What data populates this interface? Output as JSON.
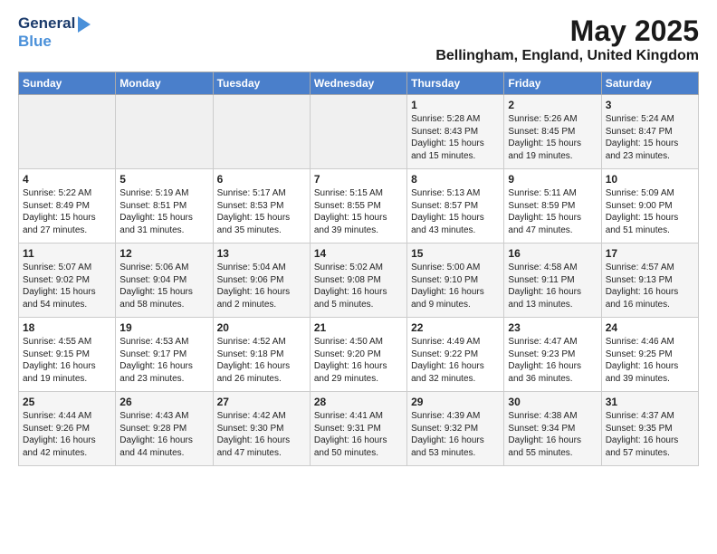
{
  "logo": {
    "line1": "General",
    "line2": "Blue"
  },
  "title": "May 2025",
  "subtitle": "Bellingham, England, United Kingdom",
  "days_header": [
    "Sunday",
    "Monday",
    "Tuesday",
    "Wednesday",
    "Thursday",
    "Friday",
    "Saturday"
  ],
  "weeks": [
    [
      {
        "day": "",
        "content": ""
      },
      {
        "day": "",
        "content": ""
      },
      {
        "day": "",
        "content": ""
      },
      {
        "day": "",
        "content": ""
      },
      {
        "day": "1",
        "content": "Sunrise: 5:28 AM\nSunset: 8:43 PM\nDaylight: 15 hours\nand 15 minutes."
      },
      {
        "day": "2",
        "content": "Sunrise: 5:26 AM\nSunset: 8:45 PM\nDaylight: 15 hours\nand 19 minutes."
      },
      {
        "day": "3",
        "content": "Sunrise: 5:24 AM\nSunset: 8:47 PM\nDaylight: 15 hours\nand 23 minutes."
      }
    ],
    [
      {
        "day": "4",
        "content": "Sunrise: 5:22 AM\nSunset: 8:49 PM\nDaylight: 15 hours\nand 27 minutes."
      },
      {
        "day": "5",
        "content": "Sunrise: 5:19 AM\nSunset: 8:51 PM\nDaylight: 15 hours\nand 31 minutes."
      },
      {
        "day": "6",
        "content": "Sunrise: 5:17 AM\nSunset: 8:53 PM\nDaylight: 15 hours\nand 35 minutes."
      },
      {
        "day": "7",
        "content": "Sunrise: 5:15 AM\nSunset: 8:55 PM\nDaylight: 15 hours\nand 39 minutes."
      },
      {
        "day": "8",
        "content": "Sunrise: 5:13 AM\nSunset: 8:57 PM\nDaylight: 15 hours\nand 43 minutes."
      },
      {
        "day": "9",
        "content": "Sunrise: 5:11 AM\nSunset: 8:59 PM\nDaylight: 15 hours\nand 47 minutes."
      },
      {
        "day": "10",
        "content": "Sunrise: 5:09 AM\nSunset: 9:00 PM\nDaylight: 15 hours\nand 51 minutes."
      }
    ],
    [
      {
        "day": "11",
        "content": "Sunrise: 5:07 AM\nSunset: 9:02 PM\nDaylight: 15 hours\nand 54 minutes."
      },
      {
        "day": "12",
        "content": "Sunrise: 5:06 AM\nSunset: 9:04 PM\nDaylight: 15 hours\nand 58 minutes."
      },
      {
        "day": "13",
        "content": "Sunrise: 5:04 AM\nSunset: 9:06 PM\nDaylight: 16 hours\nand 2 minutes."
      },
      {
        "day": "14",
        "content": "Sunrise: 5:02 AM\nSunset: 9:08 PM\nDaylight: 16 hours\nand 5 minutes."
      },
      {
        "day": "15",
        "content": "Sunrise: 5:00 AM\nSunset: 9:10 PM\nDaylight: 16 hours\nand 9 minutes."
      },
      {
        "day": "16",
        "content": "Sunrise: 4:58 AM\nSunset: 9:11 PM\nDaylight: 16 hours\nand 13 minutes."
      },
      {
        "day": "17",
        "content": "Sunrise: 4:57 AM\nSunset: 9:13 PM\nDaylight: 16 hours\nand 16 minutes."
      }
    ],
    [
      {
        "day": "18",
        "content": "Sunrise: 4:55 AM\nSunset: 9:15 PM\nDaylight: 16 hours\nand 19 minutes."
      },
      {
        "day": "19",
        "content": "Sunrise: 4:53 AM\nSunset: 9:17 PM\nDaylight: 16 hours\nand 23 minutes."
      },
      {
        "day": "20",
        "content": "Sunrise: 4:52 AM\nSunset: 9:18 PM\nDaylight: 16 hours\nand 26 minutes."
      },
      {
        "day": "21",
        "content": "Sunrise: 4:50 AM\nSunset: 9:20 PM\nDaylight: 16 hours\nand 29 minutes."
      },
      {
        "day": "22",
        "content": "Sunrise: 4:49 AM\nSunset: 9:22 PM\nDaylight: 16 hours\nand 32 minutes."
      },
      {
        "day": "23",
        "content": "Sunrise: 4:47 AM\nSunset: 9:23 PM\nDaylight: 16 hours\nand 36 minutes."
      },
      {
        "day": "24",
        "content": "Sunrise: 4:46 AM\nSunset: 9:25 PM\nDaylight: 16 hours\nand 39 minutes."
      }
    ],
    [
      {
        "day": "25",
        "content": "Sunrise: 4:44 AM\nSunset: 9:26 PM\nDaylight: 16 hours\nand 42 minutes."
      },
      {
        "day": "26",
        "content": "Sunrise: 4:43 AM\nSunset: 9:28 PM\nDaylight: 16 hours\nand 44 minutes."
      },
      {
        "day": "27",
        "content": "Sunrise: 4:42 AM\nSunset: 9:30 PM\nDaylight: 16 hours\nand 47 minutes."
      },
      {
        "day": "28",
        "content": "Sunrise: 4:41 AM\nSunset: 9:31 PM\nDaylight: 16 hours\nand 50 minutes."
      },
      {
        "day": "29",
        "content": "Sunrise: 4:39 AM\nSunset: 9:32 PM\nDaylight: 16 hours\nand 53 minutes."
      },
      {
        "day": "30",
        "content": "Sunrise: 4:38 AM\nSunset: 9:34 PM\nDaylight: 16 hours\nand 55 minutes."
      },
      {
        "day": "31",
        "content": "Sunrise: 4:37 AM\nSunset: 9:35 PM\nDaylight: 16 hours\nand 57 minutes."
      }
    ]
  ]
}
